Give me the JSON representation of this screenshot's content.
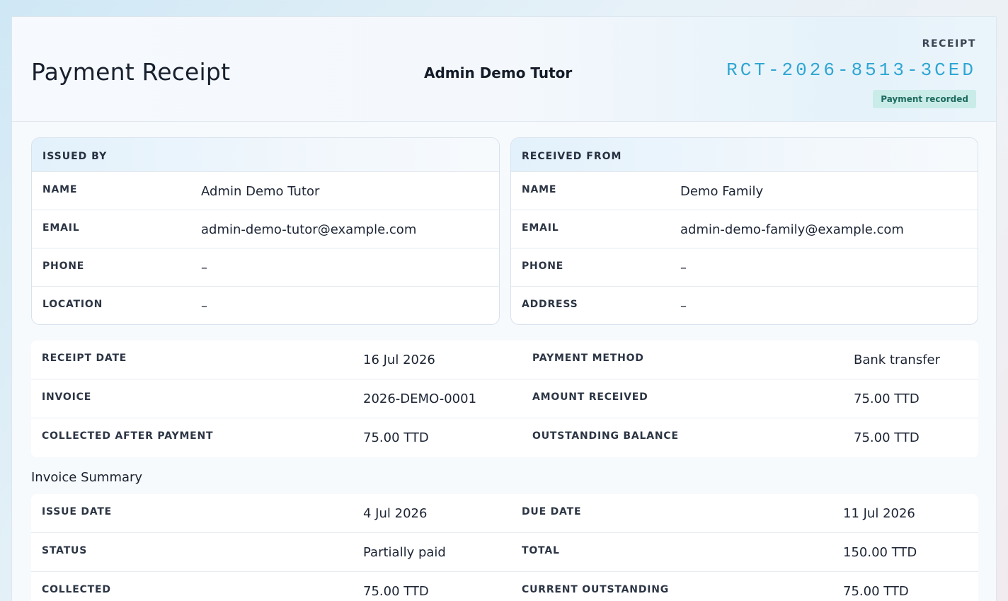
{
  "header": {
    "title": "Payment Receipt",
    "tutor_name": "Admin Demo Tutor",
    "receipt_label": "RECEIPT",
    "receipt_number": "RCT-2026-8513-3CED",
    "status": "Payment recorded"
  },
  "issued_by": {
    "heading": "ISSUED BY",
    "rows": [
      {
        "label": "NAME",
        "value": "Admin Demo Tutor"
      },
      {
        "label": "EMAIL",
        "value": "admin-demo-tutor@example.com"
      },
      {
        "label": "PHONE",
        "value": "–"
      },
      {
        "label": "LOCATION",
        "value": "–"
      }
    ]
  },
  "received_from": {
    "heading": "RECEIVED FROM",
    "rows": [
      {
        "label": "NAME",
        "value": "Demo Family"
      },
      {
        "label": "EMAIL",
        "value": "admin-demo-family@example.com"
      },
      {
        "label": "PHONE",
        "value": "–"
      },
      {
        "label": "ADDRESS",
        "value": "–"
      }
    ]
  },
  "payment_details": [
    {
      "label1": "RECEIPT DATE",
      "value1": "16 Jul 2026",
      "label2": "PAYMENT METHOD",
      "value2": "Bank transfer"
    },
    {
      "label1": "INVOICE",
      "value1": "2026-DEMO-0001",
      "label2": "AMOUNT RECEIVED",
      "value2": "75.00 TTD"
    },
    {
      "label1": "COLLECTED AFTER PAYMENT",
      "value1": "75.00 TTD",
      "label2": "OUTSTANDING BALANCE",
      "value2": "75.00 TTD"
    }
  ],
  "invoice_summary": {
    "title": "Invoice Summary",
    "rows": [
      {
        "label1": "ISSUE DATE",
        "value1": "4 Jul 2026",
        "label2": "DUE DATE",
        "value2": "11 Jul 2026"
      },
      {
        "label1": "STATUS",
        "value1": "Partially paid",
        "label2": "TOTAL",
        "value2": "150.00 TTD"
      },
      {
        "label1": "COLLECTED",
        "value1": "75.00 TTD",
        "label2": "CURRENT OUTSTANDING",
        "value2": "75.00 TTD"
      }
    ]
  },
  "colors": {
    "accent": "#2fa6d2",
    "badge_bg": "#c9ece8",
    "badge_text": "#1d6a5e"
  }
}
